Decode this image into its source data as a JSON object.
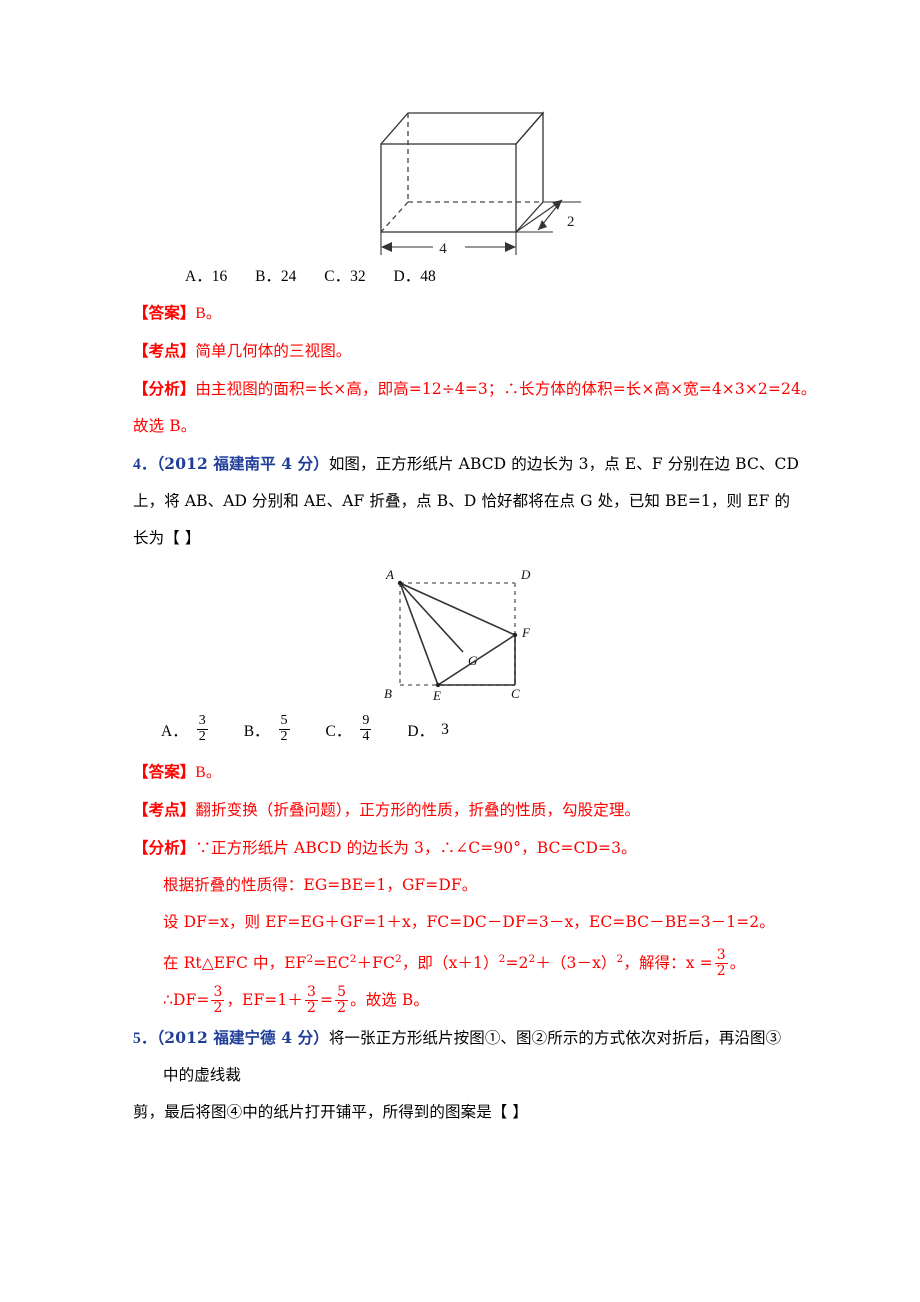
{
  "document": {
    "type": "math-exam-solutions-page",
    "language": "zh-CN",
    "accent_red": "#ff0000",
    "accent_blue": "#1f3d99"
  },
  "figure_cuboid": {
    "name": "rectangular-prism-with-dimensions",
    "width_label": "4",
    "depth_label": "2"
  },
  "q3": {
    "options_line": "A．16    B．24    C．32    D．48",
    "options": [
      {
        "letter": "A．",
        "value": "16"
      },
      {
        "letter": "B．",
        "value": "24"
      },
      {
        "letter": "C．",
        "value": "32"
      },
      {
        "letter": "D．",
        "value": "48"
      }
    ],
    "answer_tag": "【答案】",
    "answer_text": "B。",
    "keypoint_tag": "【考点】",
    "keypoint_text": "简单几何体的三视图。",
    "analysis_tag": "【分析】",
    "analysis_text": "由主视图的面积=长×高，即高=12÷4=3；∴长方体的体积=长×高×宽=4×3×2=24。",
    "analysis_text2": "故选 B。"
  },
  "q4": {
    "number": "4．",
    "source": "（2012 福建南平 4 分）",
    "stem_line1": "如图，正方形纸片 ABCD 的边长为 3，点 E、F 分别在边 BC、CD",
    "stem_line2": "上，将 AB、AD 分别和 AE、AF 折叠，点 B、D 恰好都将在点 G 处，已知 BE=1，则 EF 的",
    "stem_line3": "长为【      】",
    "figure": {
      "name": "square-abcd-folded",
      "vertex_labels": [
        "A",
        "D",
        "F",
        "G",
        "B",
        "E",
        "C"
      ]
    },
    "options": [
      {
        "letter": "A．",
        "num": "3",
        "den": "2"
      },
      {
        "letter": "B．",
        "num": "5",
        "den": "2"
      },
      {
        "letter": "C．",
        "num": "9",
        "den": "4"
      },
      {
        "letter": "D．",
        "plain": "3"
      }
    ],
    "answer_tag": "【答案】",
    "answer_text": "B。",
    "keypoint_tag": "【考点】",
    "keypoint_text": "翻折变换（折叠问题），正方形的性质，折叠的性质，勾股定理。",
    "analysis_tag": "【分析】",
    "analysis_line1": "∵正方形纸片 ABCD 的边长为 3，∴∠C=90°，BC=CD=3。",
    "analysis_line2": "根据折叠的性质得：EG=BE=1，GF=DF。",
    "analysis_line3": "设 DF=x，则 EF=EG＋GF=1＋x，FC=DC－DF=3－x，EC=BC－BE=3－1=2。",
    "analysis_line4_a": "在 Rt△EFC 中，EF",
    "analysis_line4_b": "=EC",
    "analysis_line4_c": "＋FC",
    "analysis_line4_d": "，即（x＋1）",
    "analysis_line4_e": "=2",
    "analysis_line4_f": "＋（3－x）",
    "analysis_line4_g": "，解得：x =",
    "analysis_line4_frac_num": "3",
    "analysis_line4_frac_den": "2",
    "analysis_line4_end": "。",
    "analysis_line5_a": "∴DF=",
    "analysis_line5_frac1_num": "3",
    "analysis_line5_frac1_den": "2",
    "analysis_line5_b": "，EF=1＋",
    "analysis_line5_frac2_num": "3",
    "analysis_line5_frac2_den": "2",
    "analysis_line5_c": "=",
    "analysis_line5_frac3_num": "5",
    "analysis_line5_frac3_den": "2",
    "analysis_line5_d": "。故选 B。",
    "exp_2_a": "2",
    "exp_2_b": "2",
    "exp_2_c": "2",
    "exp_2_d": "2",
    "exp_2_e": "2"
  },
  "q5": {
    "number": "5．",
    "source": "（2012 福建宁德 4 分）",
    "stem_line1": "将一张正方形纸片按图①、图②所示的方式依次对折后，再沿图③",
    "stem_line2": "中的虚线裁",
    "stem_line3": "剪，最后将图④中的纸片打开铺平，所得到的图案是【      】"
  }
}
